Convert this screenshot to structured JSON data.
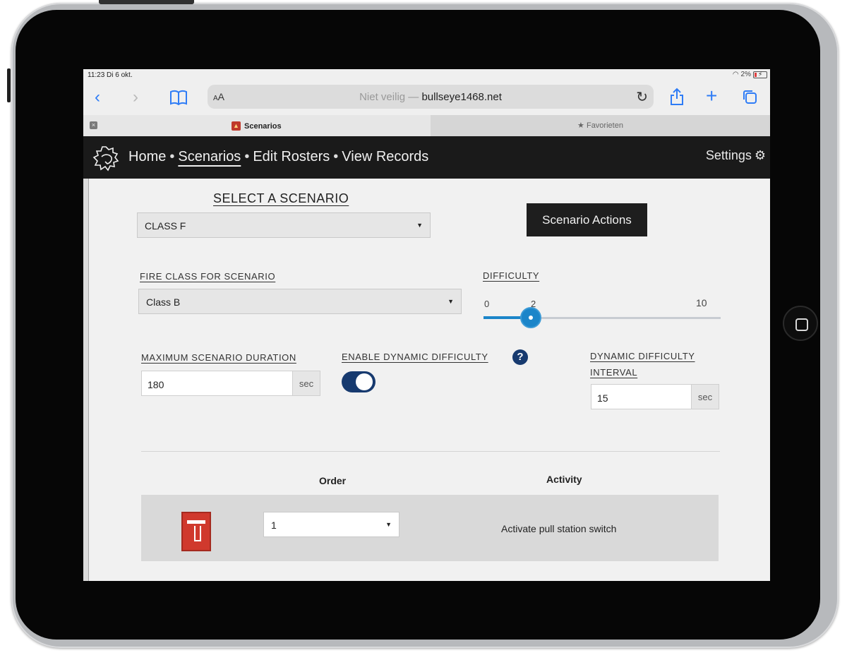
{
  "status_bar": {
    "time": "11:23  Di 6 okt.",
    "battery": "2%"
  },
  "browser": {
    "reader_label": "A",
    "reader_label_small": "A",
    "url_prefix": "Niet veilig — ",
    "url_domain": "bullseye1468.net",
    "tabs": [
      {
        "label": "Scenarios",
        "active": true
      },
      {
        "label": "Favorieten",
        "active": false
      }
    ]
  },
  "nav": {
    "home": "Home",
    "separator": "•",
    "scenarios": "Scenarios",
    "edit_rosters": "Edit Rosters",
    "view_records": "View Records",
    "settings": "Settings"
  },
  "scenario": {
    "title": "SELECT A SCENARIO",
    "selected": "CLASS F",
    "actions_label": "Scenario Actions"
  },
  "fire_class": {
    "label": "FIRE CLASS FOR SCENARIO",
    "selected": "Class B"
  },
  "difficulty": {
    "label": "DIFFICULTY",
    "min": 0,
    "max": 10,
    "value": 2
  },
  "duration": {
    "label": "MAXIMUM SCENARIO DURATION",
    "value": "180",
    "unit": "sec"
  },
  "dynamic_difficulty": {
    "label": "ENABLE DYNAMIC DIFFICULTY",
    "enabled": true,
    "help": "?"
  },
  "dynamic_interval": {
    "label_line1": "DYNAMIC DIFFICULTY",
    "label_line2": "INTERVAL",
    "value": "15",
    "unit": "sec"
  },
  "table": {
    "order_header": "Order",
    "activity_header": "Activity",
    "rows": [
      {
        "order": "1",
        "activity": "Activate pull station switch"
      }
    ]
  },
  "colors": {
    "accent": "#1b85c9",
    "toggle": "#173a6f",
    "nav_bg": "#1a1a1a"
  }
}
